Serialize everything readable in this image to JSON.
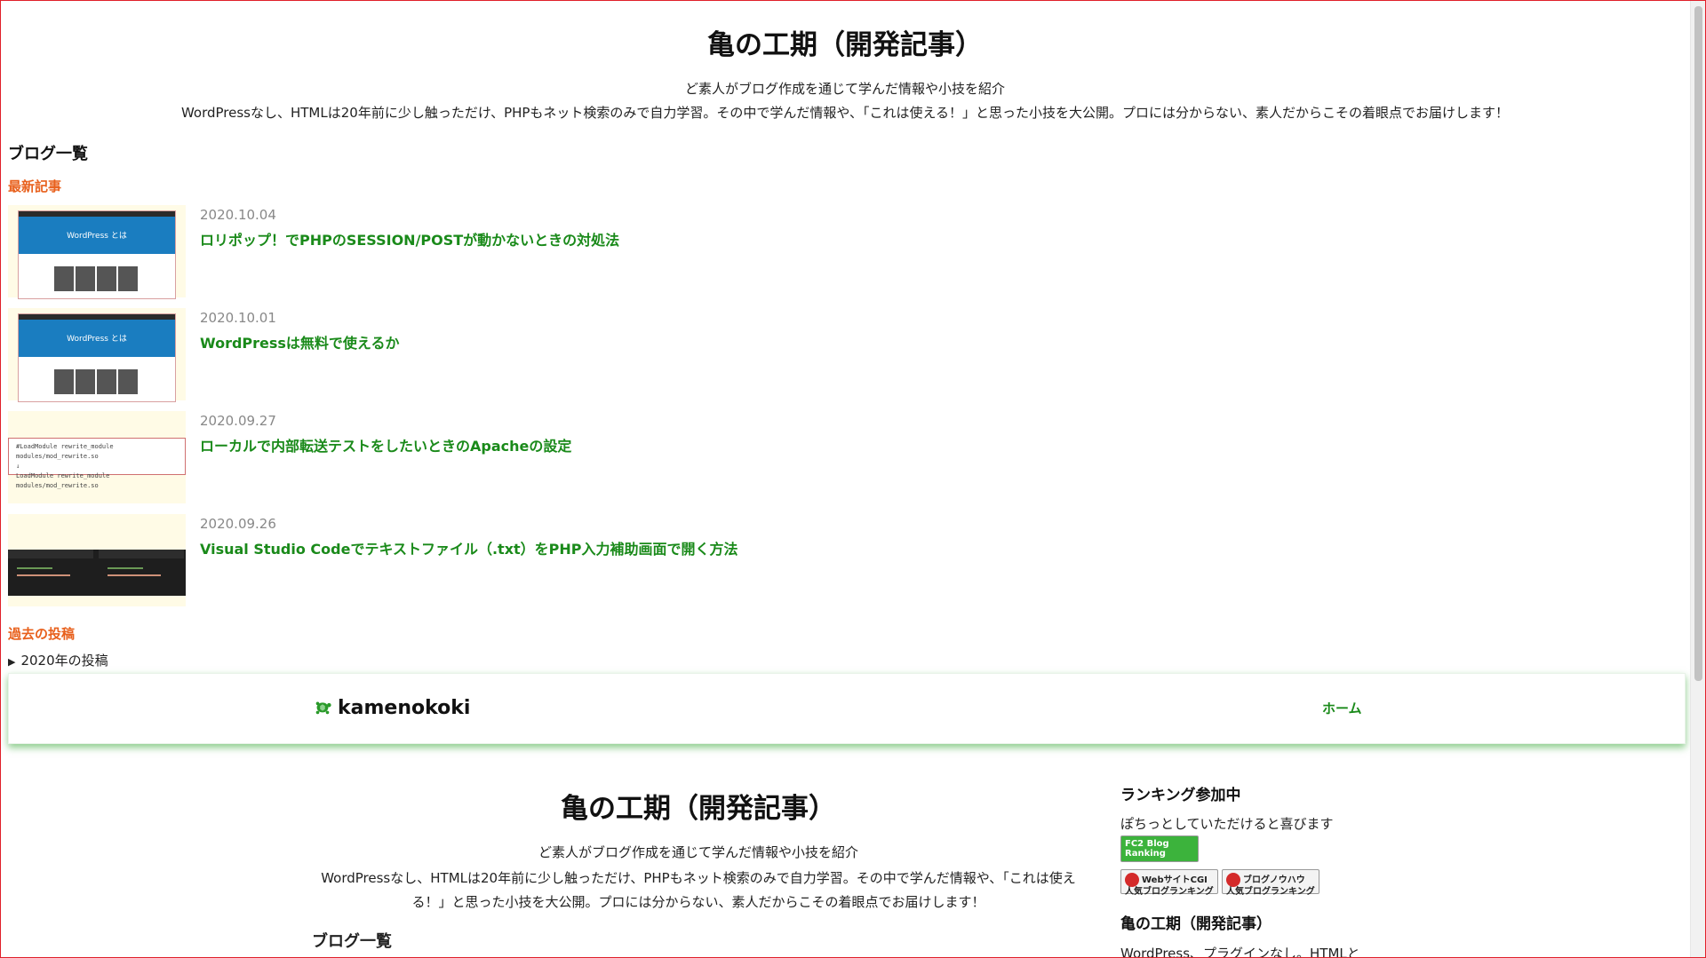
{
  "header": {
    "title": "亀の工期（開発記事）",
    "tagline": "ど素人がブログ作成を通じて学んだ情報や小技を紹介",
    "description": "WordPressなし、HTMLは20年前に少し触っただけ、PHPもネット検索のみで自力学習。その中で学んだ情報や、「これは使える！」と思った小技を大公開。プロには分からない、素人だからこその着眼点でお届けします！"
  },
  "blog_list": {
    "heading": "ブログ一覧",
    "latest_label": "最新記事",
    "posts": [
      {
        "date": "2020.10.04",
        "title": "ロリポップ！でPHPのSESSION/POSTが動かないときの対処法",
        "thumb": "wordpress-screenshot"
      },
      {
        "date": "2020.10.01",
        "title": "WordPressは無料で使えるか",
        "thumb": "wordpress-screenshot"
      },
      {
        "date": "2020.09.27",
        "title": "ローカルで内部転送テストをしたいときのApacheの設定",
        "thumb": "code-snippet"
      },
      {
        "date": "2020.09.26",
        "title": "Visual Studio Codeでテキストファイル（.txt）をPHP入力補助画面で開く方法",
        "thumb": "vscode-screenshot"
      }
    ],
    "thumb_texts": {
      "wp_hero": "WordPress とは",
      "code_line1": "#LoadModule rewrite_module modules/mod_rewrite.so",
      "code_arrow": "↓",
      "code_line2": "LoadModule rewrite_module modules/mod_rewrite.so"
    },
    "past_label": "過去の投稿",
    "archive_item": "2020年の投稿"
  },
  "navbar": {
    "brand": "kamenokoki",
    "home": "ホーム"
  },
  "main2": {
    "title": "亀の工期（開発記事）",
    "tagline": "ど素人がブログ作成を通じて学んだ情報や小技を紹介",
    "description": "WordPressなし、HTMLは20年前に少し触っただけ、PHPもネット検索のみで自力学習。その中で学んだ情報や、「これは使える！」と思った小技を大公開。プロには分からない、素人だからこその着眼点でお届けします！",
    "blog_list_heading": "ブログ一覧"
  },
  "sidebar": {
    "ranking_heading": "ランキング参加中",
    "ranking_text": "ぽちっとしていただけると喜びます",
    "badge_fc2": "FC2 Blog Ranking",
    "badge_cgi": "WebサイトCGI 人気ブログランキング",
    "badge_know": "ブログノウハウ 人気ブログランキング",
    "about_heading": "亀の工期（開発記事）",
    "about_text": "WordPress、プラグインなし。HTMLと"
  },
  "colors": {
    "accent_orange": "#e8601c",
    "link_green": "#1a8a1a",
    "frame_red": "#e0202a"
  }
}
